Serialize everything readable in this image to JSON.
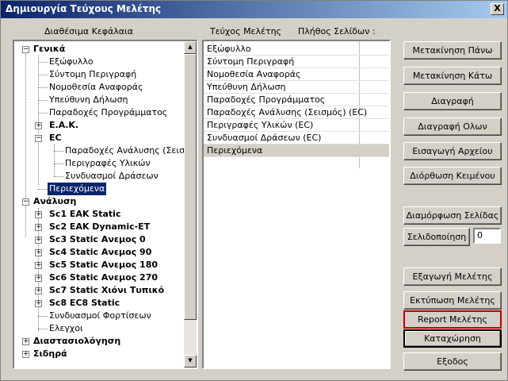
{
  "window": {
    "title": "Δημιουργία Τεύχους Μελέτης",
    "close_label": "X"
  },
  "labels": {
    "available_chapters": "Διαθέσιμα Κεφάλαια",
    "report_volume": "Τεύχος Μελέτης",
    "page_count": "Πλήθος Σελίδων :"
  },
  "tree": {
    "general": "Γενικά",
    "general_items": [
      "Εξώφυλλο",
      "Σύντομη Περιγραφή",
      "Νομοθεσία Αναφοράς",
      "Υπεύθυνη Δήλωση",
      "Παραδοχές Προγράμματος"
    ],
    "eak": "Ε.Α.Κ.",
    "ec": "EC",
    "ec_items": [
      "Παραδοχές Ανάλυσης (Σεισμός)",
      "Περιγραφές Υλικών",
      "Συνδυασμοί Δράσεων"
    ],
    "contents": "Περιεχόμενα",
    "analysis": "Ανάλυση",
    "analysis_items": [
      "Sc1 EAK Static",
      "Sc2 EAK Dynamic-ET",
      "Sc3 Static Ανεμος 0",
      "Sc4 Static Ανεμος 90",
      "Sc5 Static Ανεμος 180",
      "Sc6 Static Ανεμος 270",
      "Sc7 Static Χιόνι Τυπικό",
      "Sc8 EC8 Static"
    ],
    "analysis_leaves": [
      "Συνδυασμοί Φορτίσεων",
      "Ελεγχοι"
    ],
    "dimensioning": "Διαστασιολόγηση",
    "rebar": "Σιδηρά"
  },
  "list": {
    "rows": [
      "Εξώφυλλο",
      "Σύντομη Περιγραφή",
      "Νομοθεσία Αναφοράς",
      "Υπεύθυνη Δήλωση",
      "Παραδοχές Προγράμματος",
      "Παραδοχές Ανάλυσης (Σεισμός) (EC)",
      "Περιγραφές Υλικών (EC)",
      "Συνδυασμοί Δράσεων (EC)",
      "Περιεχόμενα"
    ]
  },
  "buttons": {
    "move_up": "Μετακίνηση Πάνω",
    "move_down": "Μετακίνηση Κάτω",
    "delete": "Διαγραφή",
    "delete_all": "Διαγραφή Ολων",
    "import_file": "Εισαγωγή Αρχείου",
    "edit_text": "Διόρθωση Κειμένου",
    "page_setup": "Διαμόρφωση Σελίδας",
    "paginate": "Σελιδοποίηση",
    "export": "Εξαγωγή Μελέτης",
    "print": "Εκτύπωση Μελέτης",
    "report": "Report Μελέτης",
    "save": "Καταχώρηση",
    "exit": "Εξοδος"
  },
  "page_number_value": "0",
  "colors": {
    "title_start": "#0a246a",
    "title_end": "#a6caf0",
    "selection": "#0a246a",
    "highlight_border": "#c00000"
  }
}
